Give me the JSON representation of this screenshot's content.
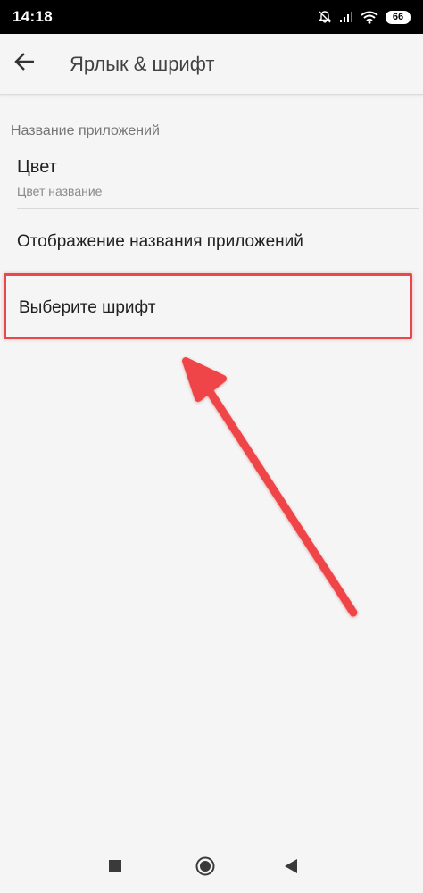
{
  "status_bar": {
    "time": "14:18",
    "battery": "66",
    "icons": [
      "bell-muted-icon",
      "signal-icon",
      "wifi-icon",
      "battery-icon"
    ]
  },
  "toolbar": {
    "title": "Ярлык & шрифт",
    "back_icon": "arrow-back-icon"
  },
  "section": {
    "header": "Название приложений",
    "items": [
      {
        "title": "Цвет",
        "summary": "Цвет название"
      },
      {
        "title": "Отображение названия приложений"
      },
      {
        "title": "Выберите шрифт",
        "highlighted": true
      }
    ]
  },
  "annotation": {
    "type": "arrow",
    "color": "#e5484d",
    "points_to": "Выберите шрифт"
  },
  "nav_bar": {
    "buttons": [
      "recents-square-icon",
      "home-circle-icon",
      "back-triangle-icon"
    ]
  }
}
